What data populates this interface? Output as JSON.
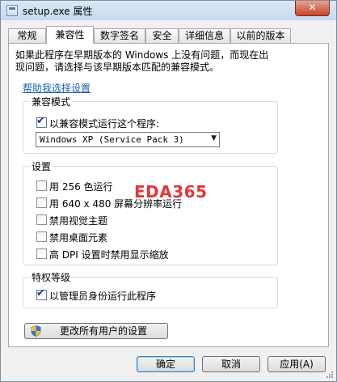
{
  "window": {
    "title": "setup.exe 属性",
    "close_glyph": "✕"
  },
  "tabs": [
    {
      "label": "常规",
      "active": false
    },
    {
      "label": "兼容性",
      "active": true
    },
    {
      "label": "数字签名",
      "active": false
    },
    {
      "label": "安全",
      "active": false
    },
    {
      "label": "详细信息",
      "active": false
    },
    {
      "label": "以前的版本",
      "active": false
    }
  ],
  "compat": {
    "description_line1": "如果此程序在早期版本的 Windows 上没有问题，而现在出",
    "description_line2": "现问题，请选择与该早期版本匹配的兼容模式。",
    "help_link": "帮助我选择设置",
    "mode_group": {
      "label": "兼容模式",
      "checkbox_label": "以兼容模式运行这个程序:",
      "checked": true,
      "selected_os": "Windows XP (Service Pack 3)"
    },
    "settings_group": {
      "label": "设置",
      "options": [
        {
          "label": "用 256 色运行",
          "checked": false
        },
        {
          "label": "用 640 x 480 屏幕分辨率运行",
          "checked": false
        },
        {
          "label": "禁用视觉主题",
          "checked": false
        },
        {
          "label": "禁用桌面元素",
          "checked": false
        },
        {
          "label": "高 DPI 设置时禁用显示缩放",
          "checked": false
        }
      ]
    },
    "privilege_group": {
      "label": "特权等级",
      "checkbox_label": "以管理员身份运行此程序",
      "checked": true
    },
    "all_users_button": "更改所有用户的设置"
  },
  "watermark": "EDA365",
  "footer": {
    "ok": "确定",
    "cancel": "取消",
    "apply": "应用(A)"
  },
  "icons": {
    "shield": "uac-shield-icon",
    "check": "✔",
    "dropdown": "▼"
  }
}
